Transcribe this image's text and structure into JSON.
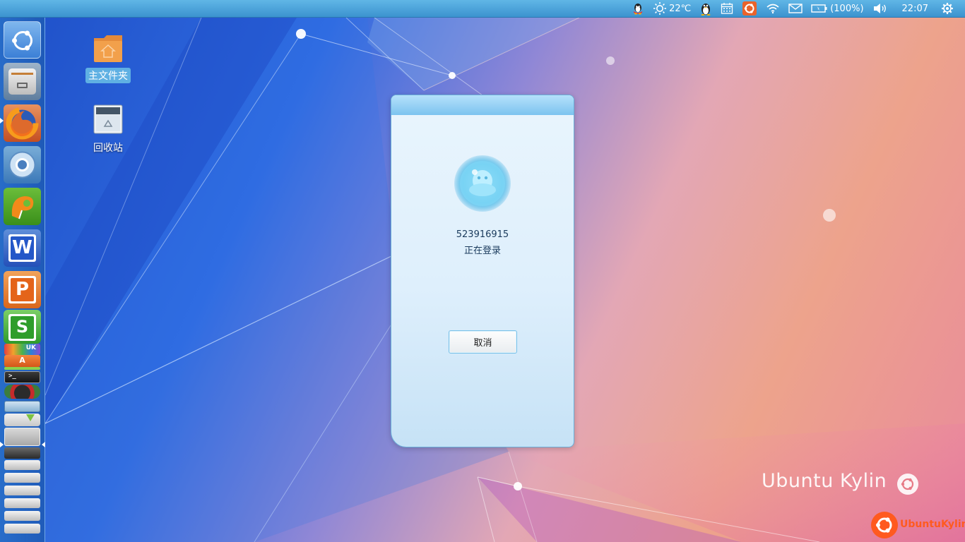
{
  "top_panel": {
    "temperature": "22℃",
    "battery": "(100%)",
    "clock": "22:07"
  },
  "desktop": {
    "items": [
      {
        "label": "主文件夹",
        "icon": "home-folder-icon"
      },
      {
        "label": "回收站",
        "icon": "trash-icon"
      }
    ]
  },
  "launcher": {
    "items": [
      "dash-home-icon",
      "file-manager-icon",
      "firefox-icon",
      "chromium-icon",
      "pydev-ide-icon",
      "wps-writer-icon",
      "wps-presentation-icon",
      "wps-spreadsheet-icon",
      "ubuntu-kylin-youker-icon",
      "software-center-icon",
      "terminal-icon",
      "disk-app-icon",
      "image-viewer-icon",
      "downloads-icon",
      "workspace-switcher-icon",
      "window-stack-icon"
    ]
  },
  "login_dialog": {
    "account": "523916915",
    "status": "正在登录",
    "cancel_label": "取消"
  },
  "branding": {
    "watermark": "Ubuntu Kylin",
    "logo_text": "UbuntuKylin"
  },
  "colors": {
    "panel": "#4aa3dc",
    "dialog_title": "#8dccf2",
    "brand_orange": "#ff5a1f"
  }
}
